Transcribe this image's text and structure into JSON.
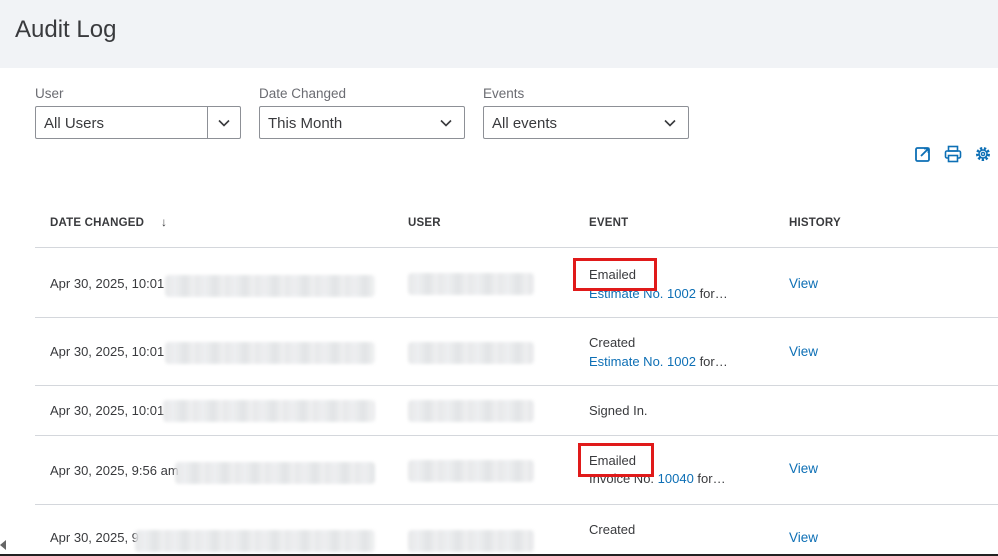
{
  "header": {
    "title": "Audit Log"
  },
  "filters": [
    {
      "label": "User",
      "value": "All Users"
    },
    {
      "label": "Date Changed",
      "value": "This Month"
    },
    {
      "label": "Events",
      "value": "All events"
    }
  ],
  "toolbar": {
    "icons": [
      "export-icon",
      "print-icon",
      "settings-gear-icon"
    ]
  },
  "table": {
    "columns": [
      "DATE CHANGED",
      "USER",
      "EVENT",
      "HISTORY"
    ],
    "sort_indicator": "↓",
    "rows": [
      {
        "date": "Apr 30, 2025, 10:01",
        "event_type": "Emailed",
        "event_link": "Estimate No. 1002",
        "event_suffix": " for…",
        "history": "View",
        "highlighted": true
      },
      {
        "date": "Apr 30, 2025, 10:01",
        "event_type": "Created",
        "event_link": "Estimate No. 1002",
        "event_suffix": " for…",
        "history": "View",
        "highlighted": false
      },
      {
        "date": "Apr 30, 2025, 10:01",
        "event_type": "Signed In.",
        "event_link": "",
        "event_suffix": "",
        "history": "",
        "highlighted": false
      },
      {
        "date": "Apr 30, 2025, 9:56 am",
        "event_type": "Emailed",
        "event_link_prefix": "Invoice No. ",
        "event_link": "10040",
        "event_suffix": " for…",
        "history": "View",
        "highlighted": true
      },
      {
        "date": "Apr 30, 2025, 9",
        "event_type": "Created",
        "event_link": "",
        "event_suffix": "",
        "history": "View",
        "highlighted": false
      }
    ]
  },
  "colors": {
    "accent": "#0d6fb5",
    "highlight": "#e01a1a",
    "header_bg": "#f1f3f6"
  }
}
